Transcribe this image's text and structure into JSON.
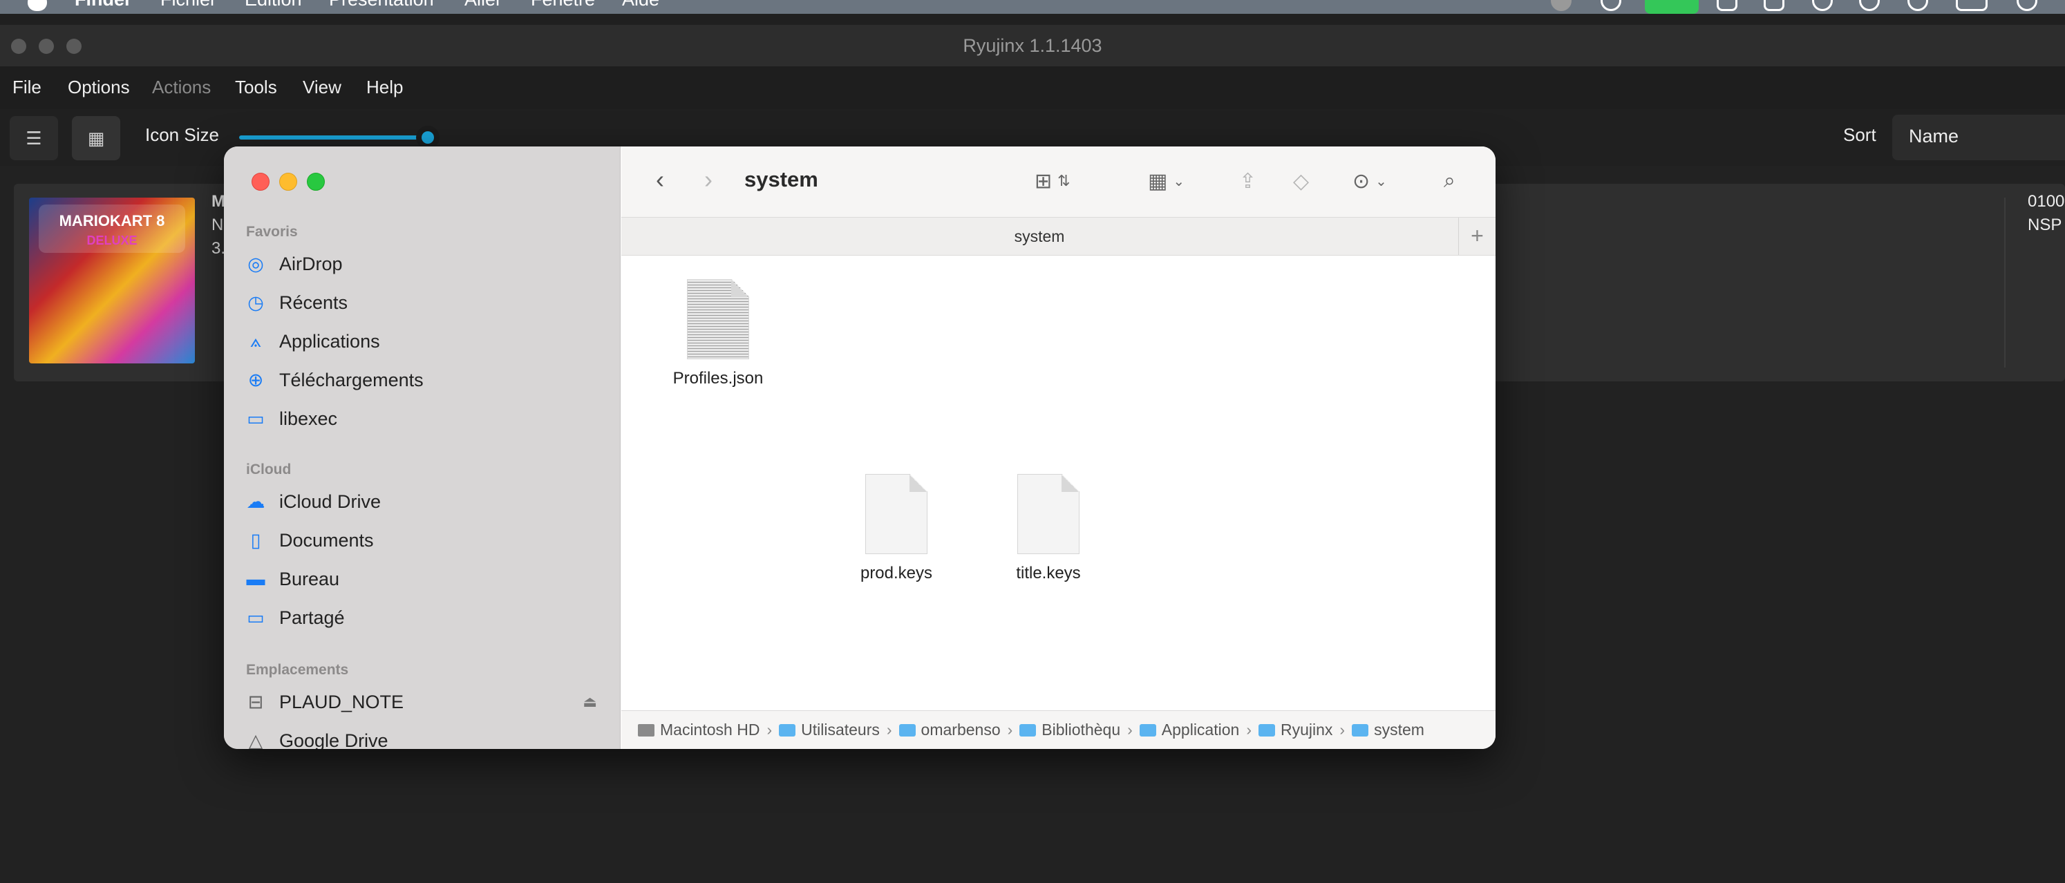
{
  "macos_menubar": {
    "items": [
      "Finder",
      "Fichier",
      "Édition",
      "Présentation",
      "Aller",
      "Fenêtre",
      "Aide"
    ]
  },
  "ryujinx": {
    "title": "Ryujinx 1.1.1403",
    "menu": [
      "File",
      "Options",
      "Actions",
      "Tools",
      "View",
      "Help"
    ],
    "toolbar": {
      "list_view_icon": "list-icon",
      "grid_view_icon": "grid-icon",
      "icon_size_label": "Icon Size",
      "icon_size_value": 0.95,
      "sort_label": "Sort",
      "sort_value": "Name"
    },
    "game": {
      "title_fragment": "M",
      "line2_fragment": "N",
      "line3_fragment": "3.",
      "id_fragment": "0100",
      "format_fragment": "NSP",
      "cover_title": "MARIOKART 8",
      "cover_subtitle": "DELUXE"
    }
  },
  "finder": {
    "folder_title": "system",
    "tab_label": "system",
    "sidebar": {
      "sections": [
        {
          "title": "Favoris",
          "items": [
            {
              "label": "AirDrop",
              "icon": "airdrop-icon"
            },
            {
              "label": "Récents",
              "icon": "clock-icon"
            },
            {
              "label": "Applications",
              "icon": "applications-icon"
            },
            {
              "label": "Téléchargements",
              "icon": "download-icon"
            },
            {
              "label": "libexec",
              "icon": "folder-icon"
            }
          ]
        },
        {
          "title": "iCloud",
          "items": [
            {
              "label": "iCloud Drive",
              "icon": "cloud-icon"
            },
            {
              "label": "Documents",
              "icon": "document-icon"
            },
            {
              "label": "Bureau",
              "icon": "desktop-icon"
            },
            {
              "label": "Partagé",
              "icon": "shared-folder-icon"
            }
          ]
        },
        {
          "title": "Emplacements",
          "items": [
            {
              "label": "PLAUD_NOTE",
              "icon": "drive-icon"
            },
            {
              "label": "Google Drive",
              "icon": "google-drive-icon"
            }
          ]
        }
      ]
    },
    "files": [
      {
        "name": "Profiles.json",
        "icon": "json-file-icon"
      },
      {
        "name": "prod.keys",
        "icon": "file-icon"
      },
      {
        "name": "title.keys",
        "icon": "file-icon"
      }
    ],
    "path": [
      "Macintosh HD",
      "Utilisateurs",
      "omarbenso",
      "Bibliothèqu",
      "Application",
      "Ryujinx",
      "system"
    ]
  }
}
